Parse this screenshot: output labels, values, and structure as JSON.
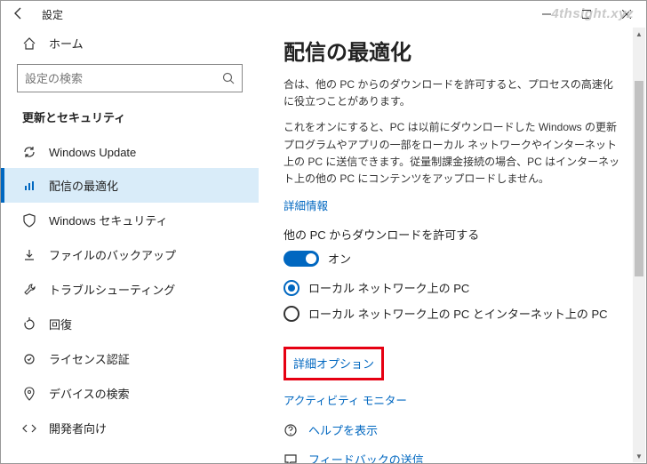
{
  "titlebar": {
    "title": "設定"
  },
  "sidebar": {
    "home": "ホーム",
    "search_placeholder": "設定の検索",
    "section": "更新とセキュリティ",
    "items": [
      {
        "label": "Windows Update"
      },
      {
        "label": "配信の最適化"
      },
      {
        "label": "Windows セキュリティ"
      },
      {
        "label": "ファイルのバックアップ"
      },
      {
        "label": "トラブルシューティング"
      },
      {
        "label": "回復"
      },
      {
        "label": "ライセンス認証"
      },
      {
        "label": "デバイスの検索"
      },
      {
        "label": "開発者向け"
      }
    ]
  },
  "main": {
    "title": "配信の最適化",
    "intro": "合は、他の PC からのダウンロードを許可すると、プロセスの高速化に役立つことがあります。",
    "desc": "これをオンにすると、PC は以前にダウンロードした Windows の更新プログラムやアプリの一部をローカル ネットワークやインターネット上の PC に送信できます。従量制課金接続の場合、PC はインターネット上の他の PC にコンテンツをアップロードしません。",
    "more_info": "詳細情報",
    "allow_header": "他の PC からダウンロードを許可する",
    "toggle_state": "オン",
    "radio1": "ローカル ネットワーク上の PC",
    "radio2": "ローカル ネットワーク上の PC とインターネット上の PC",
    "advanced": "詳細オプション",
    "activity": "アクティビティ モニター",
    "help": "ヘルプを表示",
    "feedback": "フィードバックの送信"
  },
  "watermark": "4thsight.xyz"
}
